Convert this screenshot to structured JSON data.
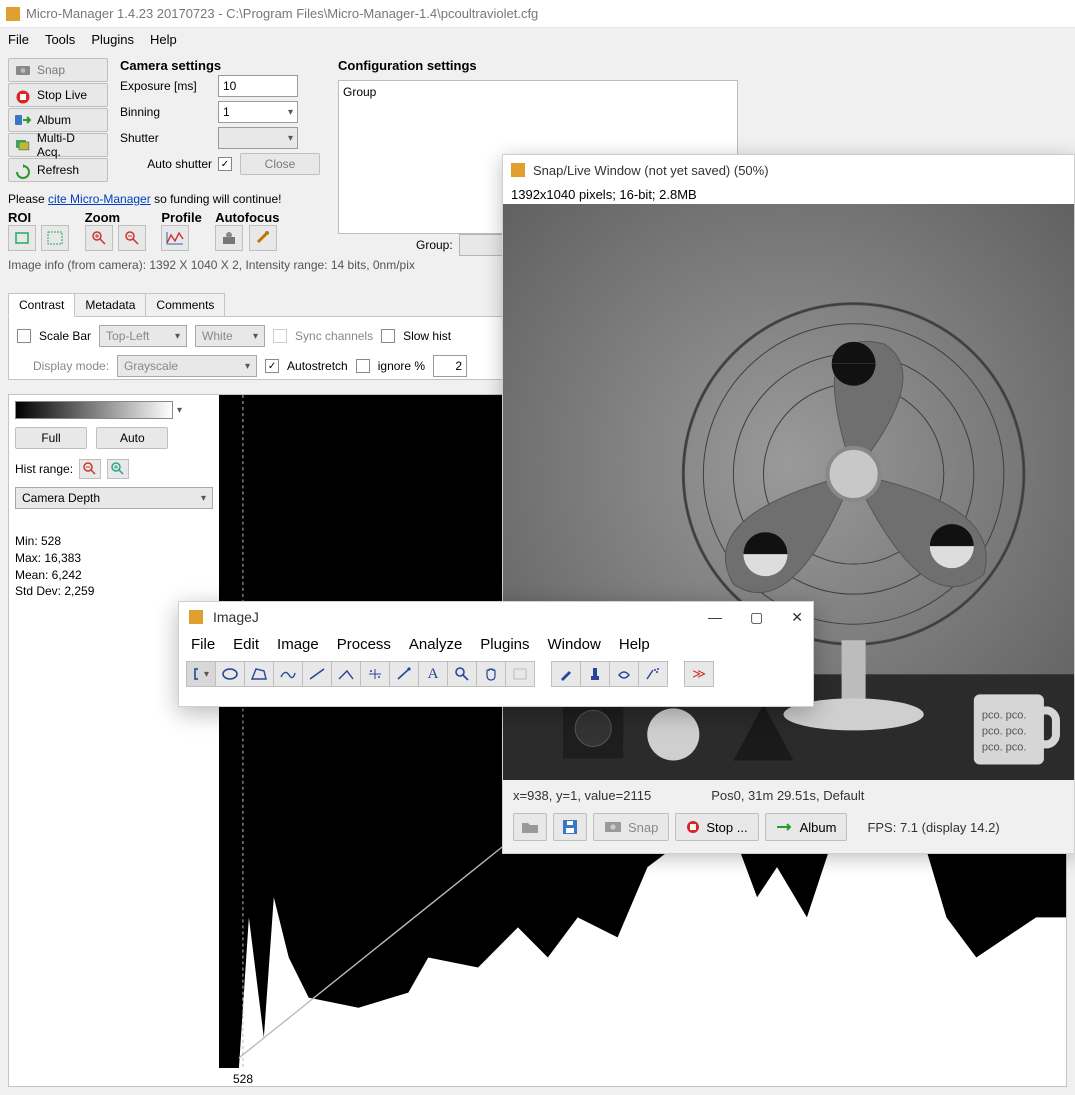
{
  "main_window": {
    "title": "Micro-Manager 1.4.23 20170723 - C:\\Program Files\\Micro-Manager-1.4\\pcoultraviolet.cfg",
    "menubar": [
      "File",
      "Tools",
      "Plugins",
      "Help"
    ],
    "buttons": {
      "snap": "Snap",
      "stop_live": "Stop Live",
      "album": "Album",
      "multi_d": "Multi-D Acq.",
      "refresh": "Refresh"
    },
    "camera": {
      "heading": "Camera settings",
      "exposure_label": "Exposure [ms]",
      "exposure_value": "10",
      "binning_label": "Binning",
      "binning_value": "1",
      "shutter_label": "Shutter",
      "shutter_value": "",
      "auto_shutter_label": "Auto shutter",
      "auto_shutter_checked": "✓",
      "close_label": "Close"
    },
    "config": {
      "heading": "Configuration settings",
      "group_label": "Group",
      "group2_label": "Group:"
    },
    "cite": {
      "pre": "Please ",
      "link": "cite Micro-Manager",
      "post": " so funding will continue!"
    },
    "tools": {
      "roi": "ROI",
      "zoom": "Zoom",
      "profile": "Profile",
      "autofocus": "Autofocus"
    },
    "image_info": "Image info (from camera): 1392 X 1040 X 2, Intensity range: 14 bits, 0nm/pix"
  },
  "tabs": {
    "contrast": "Contrast",
    "metadata": "Metadata",
    "comments": "Comments",
    "scale_bar": "Scale Bar",
    "scale_pos": "Top-Left",
    "scale_color": "White",
    "sync": "Sync channels",
    "slow": "Slow hist",
    "display_mode_label": "Display mode:",
    "display_mode": "Grayscale",
    "autostretch": "Autostretch",
    "ignore": "ignore %",
    "ignore_val": "2"
  },
  "hist": {
    "full": "Full",
    "auto": "Auto",
    "hist_range": "Hist range:",
    "depth": "Camera Depth",
    "stats": {
      "min": "Min: 528",
      "max": "Max: 16,383",
      "mean": "Mean: 6,242",
      "std": "Std Dev: 2,259"
    },
    "xlabel": "528"
  },
  "snap_window": {
    "title": "Snap/Live Window (not yet saved) (50%)",
    "meta": "1392x1040 pixels; 16-bit; 2.8MB",
    "status_xy": "x=938, y=1, value=2115",
    "status_pos": "Pos0, 31m 29.51s, Default",
    "toolbar": {
      "snap": "Snap",
      "stop": "Stop ...",
      "album": "Album"
    },
    "fps": "FPS: 7.1 (display 14.2)"
  },
  "imagej": {
    "title": "ImageJ",
    "menu": [
      "File",
      "Edit",
      "Image",
      "Process",
      "Analyze",
      "Plugins",
      "Window",
      "Help"
    ]
  }
}
